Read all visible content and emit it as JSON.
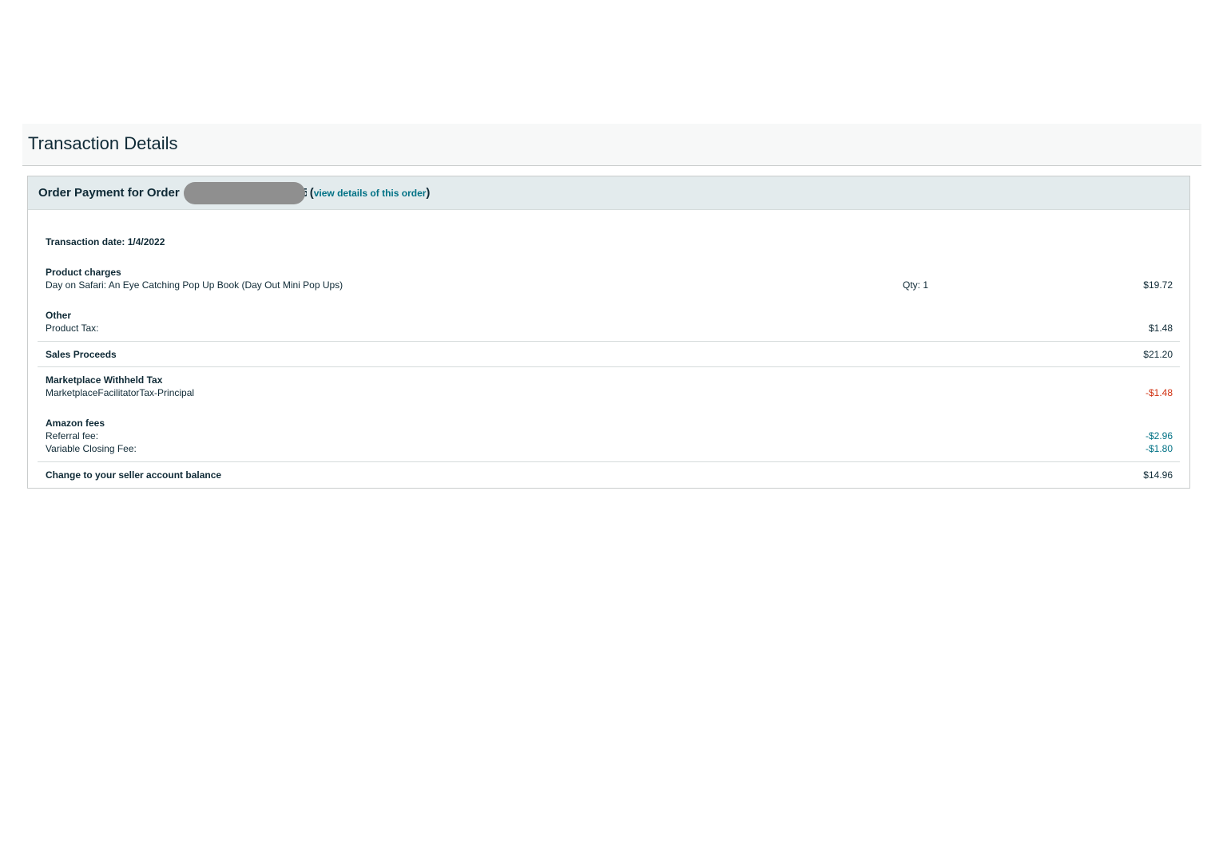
{
  "page": {
    "title": "Transaction Details"
  },
  "order": {
    "label": "Order Payment for Order",
    "tail_char": "5",
    "link_text": "view details of this order"
  },
  "transaction": {
    "date_label": "Transaction date: 1/4/2022"
  },
  "product_charges": {
    "title": "Product charges",
    "item": "Day on Safari: An Eye Catching Pop Up Book (Day Out Mini Pop Ups)",
    "qty": "Qty: 1",
    "amount": "$19.72"
  },
  "other": {
    "title": "Other",
    "label": "Product Tax:",
    "amount": "$1.48"
  },
  "sales_proceeds": {
    "title": "Sales Proceeds",
    "amount": "$21.20"
  },
  "withheld_tax": {
    "title": "Marketplace Withheld Tax",
    "label": "MarketplaceFacilitatorTax-Principal",
    "amount": "-$1.48"
  },
  "amazon_fees": {
    "title": "Amazon fees",
    "referral_label": "Referral fee:",
    "referral_amount": "-$2.96",
    "closing_label": "Variable Closing Fee:",
    "closing_amount": "-$1.80"
  },
  "balance": {
    "title": "Change to your seller account balance",
    "amount": "$14.96"
  },
  "colors": {
    "link": "#007185",
    "negative_red": "#d13212",
    "header_bg": "#e3ebed"
  }
}
